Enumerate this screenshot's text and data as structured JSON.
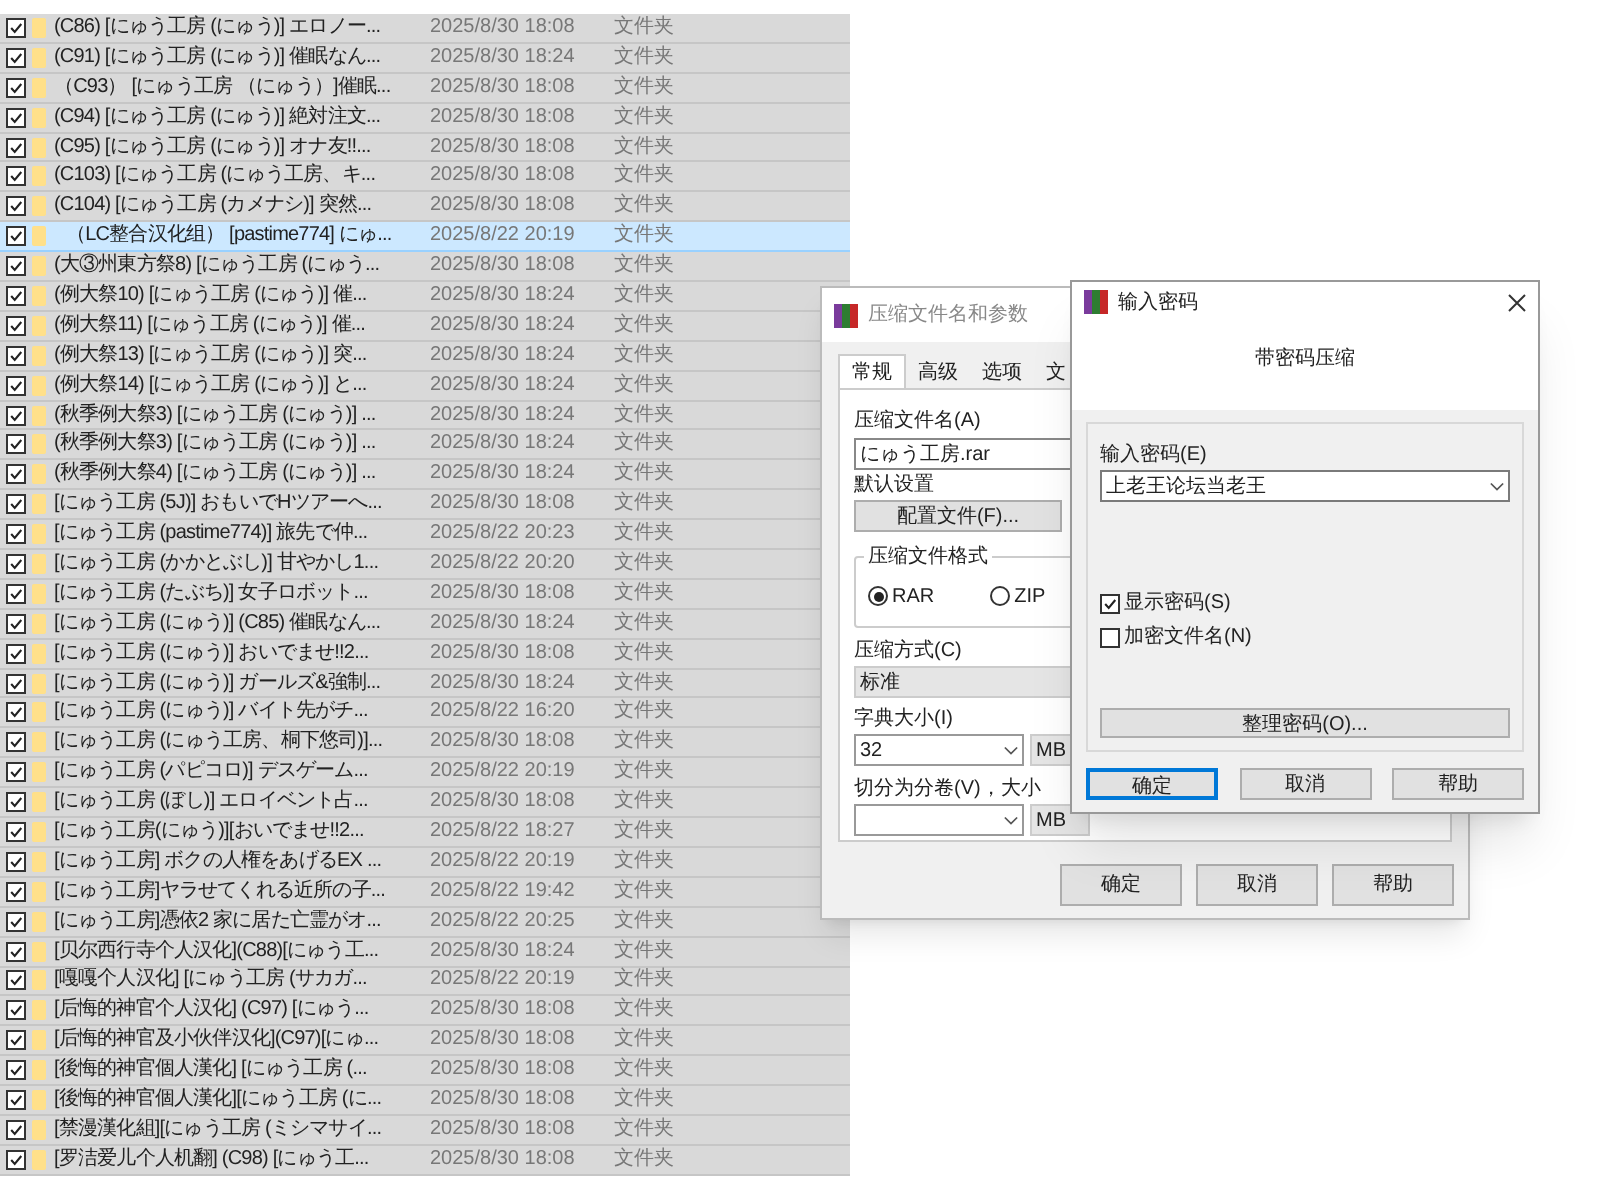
{
  "file_list": {
    "rows": [
      {
        "name": "(C86) [にゅう工房 (にゅう)] エロノー...",
        "modified": "2025/8/30 18:08",
        "type": "文件夹",
        "checked": true,
        "selected": false
      },
      {
        "name": "(C91) [にゅう工房 (にゅう)] 催眠なん...",
        "modified": "2025/8/30 18:24",
        "type": "文件夹",
        "checked": true,
        "selected": false
      },
      {
        "name": "（C93） [にゅう工房 （にゅう）]催眠...",
        "modified": "2025/8/30 18:08",
        "type": "文件夹",
        "checked": true,
        "selected": false
      },
      {
        "name": "(C94) [にゅう工房 (にゅう)] 絶対注文...",
        "modified": "2025/8/30 18:08",
        "type": "文件夹",
        "checked": true,
        "selected": false
      },
      {
        "name": "(C95) [にゅう工房 (にゅう)] オナ友!!...",
        "modified": "2025/8/30 18:08",
        "type": "文件夹",
        "checked": true,
        "selected": false
      },
      {
        "name": "(C103) [にゅう工房 (にゅう工房、キ...",
        "modified": "2025/8/30 18:08",
        "type": "文件夹",
        "checked": true,
        "selected": false
      },
      {
        "name": "(C104) [にゅう工房 (カメナシ)] 突然...",
        "modified": "2025/8/30 18:08",
        "type": "文件夹",
        "checked": true,
        "selected": false
      },
      {
        "name": "（LC整合汉化组） [pastime774] にゅ...",
        "modified": "2025/8/22 20:19",
        "type": "文件夹",
        "checked": true,
        "selected": true
      },
      {
        "name": "(大③州東方祭8) [にゅう工房 (にゅう...",
        "modified": "2025/8/30 18:08",
        "type": "文件夹",
        "checked": true,
        "selected": false
      },
      {
        "name": "(例大祭10) [にゅう工房 (にゅう)] 催...",
        "modified": "2025/8/30 18:24",
        "type": "文件夹",
        "checked": true,
        "selected": false
      },
      {
        "name": "(例大祭11) [にゅう工房 (にゅう)] 催...",
        "modified": "2025/8/30 18:24",
        "type": "文件夹",
        "checked": true,
        "selected": false
      },
      {
        "name": "(例大祭13) [にゅう工房 (にゅう)] 突...",
        "modified": "2025/8/30 18:24",
        "type": "文件夹",
        "checked": true,
        "selected": false
      },
      {
        "name": "(例大祭14) [にゅう工房 (にゅう)] と...",
        "modified": "2025/8/30 18:24",
        "type": "文件夹",
        "checked": true,
        "selected": false
      },
      {
        "name": "(秋季例大祭3) [にゅう工房 (にゅう)] ...",
        "modified": "2025/8/30 18:24",
        "type": "文件夹",
        "checked": true,
        "selected": false
      },
      {
        "name": "(秋季例大祭3) [にゅう工房 (にゅう)] ...",
        "modified": "2025/8/30 18:24",
        "type": "文件夹",
        "checked": true,
        "selected": false
      },
      {
        "name": "(秋季例大祭4) [にゅう工房 (にゅう)] ...",
        "modified": "2025/8/30 18:24",
        "type": "文件夹",
        "checked": true,
        "selected": false
      },
      {
        "name": "[にゅう工房 (5J)] おもいでHツアーへ...",
        "modified": "2025/8/30 18:08",
        "type": "文件夹",
        "checked": true,
        "selected": false
      },
      {
        "name": "[にゅう工房 (pastime774)] 旅先で仲...",
        "modified": "2025/8/22 20:23",
        "type": "文件夹",
        "checked": true,
        "selected": false
      },
      {
        "name": "[にゅう工房 (かかとぶし)] 甘やかし1...",
        "modified": "2025/8/22 20:20",
        "type": "文件夹",
        "checked": true,
        "selected": false
      },
      {
        "name": "[にゅう工房 (たぶち)] 女子ロボット...",
        "modified": "2025/8/30 18:08",
        "type": "文件夹",
        "checked": true,
        "selected": false
      },
      {
        "name": "[にゅう工房 (にゅう)] (C85) 催眠なん...",
        "modified": "2025/8/30 18:24",
        "type": "文件夹",
        "checked": true,
        "selected": false
      },
      {
        "name": "[にゅう工房 (にゅう)] おいでませ!!2...",
        "modified": "2025/8/30 18:08",
        "type": "文件夹",
        "checked": true,
        "selected": false
      },
      {
        "name": "[にゅう工房 (にゅう)] ガールズ&強制...",
        "modified": "2025/8/30 18:24",
        "type": "文件夹",
        "checked": true,
        "selected": false
      },
      {
        "name": "[にゅう工房 (にゅう)] バイト先がチ...",
        "modified": "2025/8/22 16:20",
        "type": "文件夹",
        "checked": true,
        "selected": false
      },
      {
        "name": "[にゅう工房 (にゅう工房、桐下悠司)]...",
        "modified": "2025/8/30 18:08",
        "type": "文件夹",
        "checked": true,
        "selected": false
      },
      {
        "name": "[にゅう工房 (パピコロ)] デスゲーム...",
        "modified": "2025/8/22 20:19",
        "type": "文件夹",
        "checked": true,
        "selected": false
      },
      {
        "name": "[にゅう工房 (ぼし)] エロイベント占...",
        "modified": "2025/8/30 18:08",
        "type": "文件夹",
        "checked": true,
        "selected": false
      },
      {
        "name": "[にゅう工房(にゅう)][おいでませ!!2...",
        "modified": "2025/8/22 18:27",
        "type": "文件夹",
        "checked": true,
        "selected": false
      },
      {
        "name": "[にゅう工房] ボクの人権をあげるEX ...",
        "modified": "2025/8/22 20:19",
        "type": "文件夹",
        "checked": true,
        "selected": false
      },
      {
        "name": "[にゅう工房]ヤラせてくれる近所の子...",
        "modified": "2025/8/22 19:42",
        "type": "文件夹",
        "checked": true,
        "selected": false
      },
      {
        "name": "[にゅう工房]憑依2 家に居た亡霊がオ...",
        "modified": "2025/8/22 20:25",
        "type": "文件夹",
        "checked": true,
        "selected": false
      },
      {
        "name": "[贝尔西行寺个人汉化](C88)[にゅう工...",
        "modified": "2025/8/30 18:24",
        "type": "文件夹",
        "checked": true,
        "selected": false
      },
      {
        "name": "[嘎嘎个人汉化] [にゅう工房 (サカガ...",
        "modified": "2025/8/22 20:19",
        "type": "文件夹",
        "checked": true,
        "selected": false
      },
      {
        "name": "[后悔的神官个人汉化] (C97) [にゅう...",
        "modified": "2025/8/30 18:08",
        "type": "文件夹",
        "checked": true,
        "selected": false
      },
      {
        "name": "[后悔的神官及小伙伴汉化](C97)[にゅ...",
        "modified": "2025/8/30 18:08",
        "type": "文件夹",
        "checked": true,
        "selected": false
      },
      {
        "name": "[後悔的神官個人漢化] [にゅう工房 (...",
        "modified": "2025/8/30 18:08",
        "type": "文件夹",
        "checked": true,
        "selected": false
      },
      {
        "name": "[後悔的神官個人漢化][にゅう工房 (に...",
        "modified": "2025/8/30 18:08",
        "type": "文件夹",
        "checked": true,
        "selected": false
      },
      {
        "name": "[禁漫漢化組][にゅう工房 (ミシマサイ...",
        "modified": "2025/8/30 18:08",
        "type": "文件夹",
        "checked": true,
        "selected": false
      },
      {
        "name": "[罗洁爱儿个人机翻] (C98) [にゅう工...",
        "modified": "2025/8/30 18:08",
        "type": "文件夹",
        "checked": true,
        "selected": false
      }
    ]
  },
  "archive_dialog": {
    "title": "压缩文件名和参数",
    "tabs": [
      {
        "label": "常规",
        "selected": true
      },
      {
        "label": "高级",
        "selected": false
      },
      {
        "label": "选项",
        "selected": false
      },
      {
        "label": "文",
        "selected": false
      }
    ],
    "archive_name_label": "压缩文件名(A)",
    "archive_name": "にゅう工房.rar",
    "default_settings_label": "默认设置",
    "profiles_button": "配置文件(F)...",
    "format_group": {
      "label": "压缩文件格式",
      "options": [
        {
          "label": "RAR",
          "selected": true
        },
        {
          "label": "ZIP",
          "selected": false
        }
      ]
    },
    "method_label": "压缩方式(C)",
    "method": "标准",
    "dictionary_label": "字典大小(I)",
    "dictionary": "32",
    "dictionary_unit": "MB",
    "split_label": "切分为分卷(V)，大小",
    "split_unit": "MB",
    "buttons": [
      "确定",
      "取消",
      "帮助"
    ]
  },
  "password_dialog": {
    "title": "输入密码",
    "heading": "带密码压缩",
    "password_label": "输入密码(E)",
    "password": "上老王论坛当老王",
    "options": [
      {
        "label": "显示密码(S)",
        "checked": true
      },
      {
        "label": "加密文件名(N)",
        "checked": false
      }
    ],
    "organize_button": "整理密码(O)...",
    "buttons": [
      {
        "label": "确定",
        "focused": true
      },
      {
        "label": "取消",
        "focused": false
      },
      {
        "label": "帮助",
        "focused": false
      }
    ]
  }
}
